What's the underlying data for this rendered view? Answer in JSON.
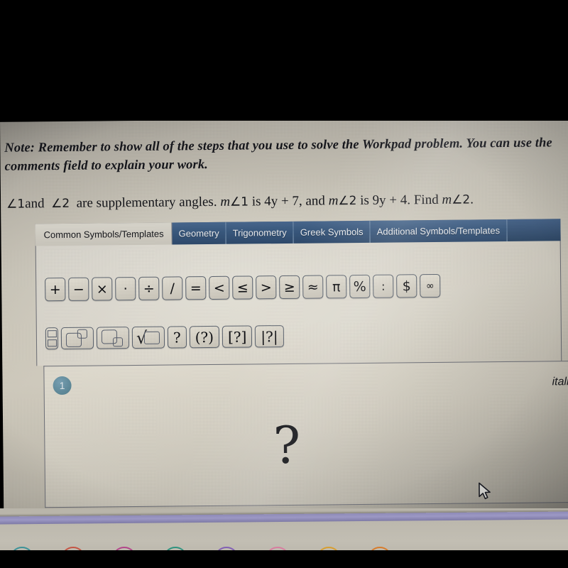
{
  "note": {
    "text": "Note: Remember to show all of the steps that you use to solve the Workpad problem. You can use the comments field to explain your work."
  },
  "problem": {
    "full_text": "∠1 and ∠2 are supplementary angles. m∠1 is 4y + 7, and m∠2 is 9y + 4. Find m∠2.",
    "angle1": "∠1",
    "and": "and",
    "angle2": "∠2",
    "mid": "are supplementary angles.",
    "m1": "m",
    "m1_angle": "∠1",
    "is1": "is 4y + 7, and",
    "m2": "m",
    "m2_angle": "∠2",
    "is2": "is 9y + 4. Find",
    "m3": "m",
    "m3_angle": "∠2",
    "period": "."
  },
  "tabs": [
    {
      "label": "Common Symbols/Templates",
      "active": true
    },
    {
      "label": "Geometry",
      "active": false
    },
    {
      "label": "Trigonometry",
      "active": false
    },
    {
      "label": "Greek Symbols",
      "active": false
    },
    {
      "label": "Additional Symbols/Templates",
      "active": false
    }
  ],
  "symbol_row_1": [
    {
      "glyph": "+",
      "name": "plus"
    },
    {
      "glyph": "−",
      "name": "minus"
    },
    {
      "glyph": "×",
      "name": "multiply"
    },
    {
      "glyph": "·",
      "name": "dot-multiply"
    },
    {
      "glyph": "÷",
      "name": "divide"
    },
    {
      "glyph": "/",
      "name": "slash-divide"
    },
    {
      "glyph": "=",
      "name": "equals"
    },
    {
      "glyph": "<",
      "name": "less-than"
    },
    {
      "glyph": "≤",
      "name": "less-than-or-equal"
    },
    {
      "glyph": ">",
      "name": "greater-than"
    },
    {
      "glyph": "≥",
      "name": "greater-than-or-equal"
    },
    {
      "glyph": "≈",
      "name": "approximately-equal"
    },
    {
      "glyph": "π",
      "name": "pi"
    },
    {
      "glyph": "%",
      "name": "percent"
    },
    {
      "glyph": ":",
      "name": "colon-ratio"
    },
    {
      "glyph": "$",
      "name": "dollar"
    },
    {
      "glyph": "∞",
      "name": "infinity"
    }
  ],
  "symbol_row_2": [
    {
      "glyph": "",
      "name": "fraction-template"
    },
    {
      "glyph": "",
      "name": "superscript-template"
    },
    {
      "glyph": "",
      "name": "subscript-template"
    },
    {
      "glyph": "",
      "name": "square-root-template"
    },
    {
      "glyph": "?",
      "name": "placeholder"
    },
    {
      "glyph": "(?)",
      "name": "parentheses-template"
    },
    {
      "glyph": "[?]",
      "name": "brackets-template"
    },
    {
      "glyph": "|?|",
      "name": "absolute-value-template"
    }
  ],
  "workpad": {
    "item_number": "1",
    "format_label": "italic",
    "answer_placeholder": "?"
  },
  "dock": {
    "icon_colors": [
      "#2f8e96",
      "#c44a3a",
      "#b03a86",
      "#1f8f7a",
      "#7b57b5",
      "#d9789e",
      "#d99b23",
      "#d9761f"
    ]
  },
  "colors": {
    "tab_active_bg": "#ded9d1",
    "tab_inactive_bg": "#3a5a80",
    "badge_bg": "#53808f",
    "screen_bg": "#c7c2b6",
    "purple_bar": "#8e8ab8"
  }
}
